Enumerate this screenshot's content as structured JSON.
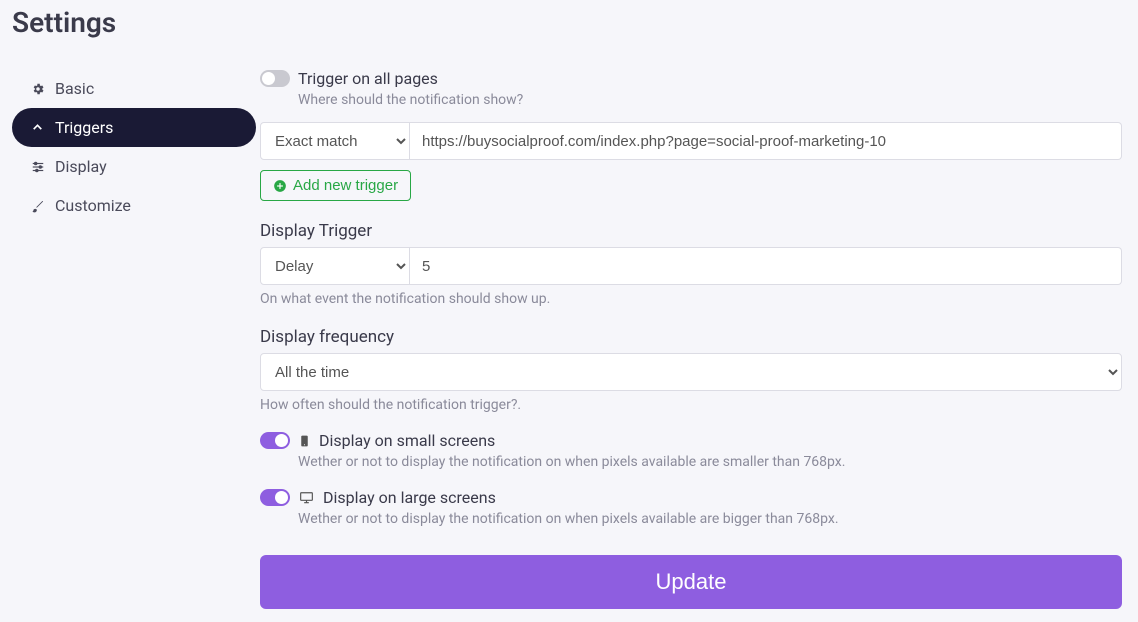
{
  "page_title": "Settings",
  "sidebar": {
    "items": [
      {
        "label": "Basic"
      },
      {
        "label": "Triggers"
      },
      {
        "label": "Display"
      },
      {
        "label": "Customize"
      }
    ]
  },
  "trigger_all_pages": {
    "label": "Trigger on all pages",
    "help": "Where should the notification show?",
    "on": false
  },
  "trigger_rule": {
    "match_type": "Exact match",
    "url": "https://buysocialproof.com/index.php?page=social-proof-marketing-10"
  },
  "add_trigger_label": "Add new trigger",
  "display_trigger": {
    "label": "Display Trigger",
    "type": "Delay",
    "value": "5",
    "help": "On what event the notification should show up."
  },
  "display_frequency": {
    "label": "Display frequency",
    "value": "All the time",
    "help": "How often should the notification trigger?."
  },
  "display_small": {
    "label": "Display on small screens",
    "help": "Wether or not to display the notification on when pixels available are smaller than 768px.",
    "on": true
  },
  "display_large": {
    "label": "Display on large screens",
    "help": "Wether or not to display the notification on when pixels available are bigger than 768px.",
    "on": true
  },
  "update_label": "Update"
}
